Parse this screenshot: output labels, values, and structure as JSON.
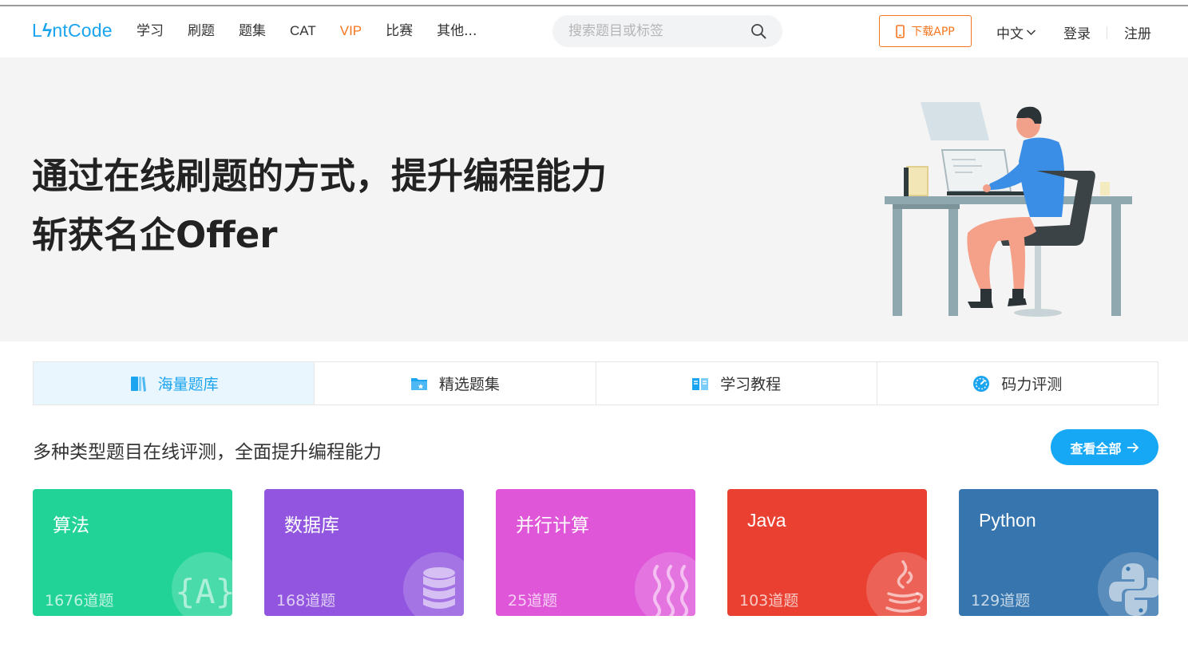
{
  "header": {
    "logo": {
      "prefix": "L",
      "suffix": "ntCode"
    },
    "nav": [
      "学习",
      "刷题",
      "题集",
      "CAT",
      "VIP",
      "比赛",
      "其他..."
    ],
    "search_placeholder": "搜索题目或标签",
    "download_app": "下载APP",
    "language": "中文",
    "login": "登录",
    "register": "注册"
  },
  "hero": {
    "line1": "通过在线刷题的方式，提升编程能力",
    "line2": "斩获名企Offer"
  },
  "tabs": [
    {
      "label": "海量题库",
      "icon": "book-icon",
      "active": true
    },
    {
      "label": "精选题集",
      "icon": "folder-icon",
      "active": false
    },
    {
      "label": "学习教程",
      "icon": "open-book-icon",
      "active": false
    },
    {
      "label": "码力评测",
      "icon": "speedometer-icon",
      "active": false
    }
  ],
  "section": {
    "title": "多种类型题目在线评测，全面提升编程能力",
    "view_all": "查看全部"
  },
  "cards": [
    {
      "title": "算法",
      "count": "1676道题",
      "color": "#22d398",
      "icon": "algorithm-icon"
    },
    {
      "title": "数据库",
      "count": "168道题",
      "color": "#9155df",
      "icon": "database-icon"
    },
    {
      "title": "并行计算",
      "count": "25道题",
      "color": "#df56d9",
      "icon": "parallel-icon"
    },
    {
      "title": "Java",
      "count": "103道题",
      "color": "#ea4032",
      "icon": "java-icon"
    },
    {
      "title": "Python",
      "count": "129道题",
      "color": "#3675ad",
      "icon": "python-icon"
    }
  ],
  "colors": {
    "brand": "#1ba4f0",
    "accent": "#f5761f"
  }
}
